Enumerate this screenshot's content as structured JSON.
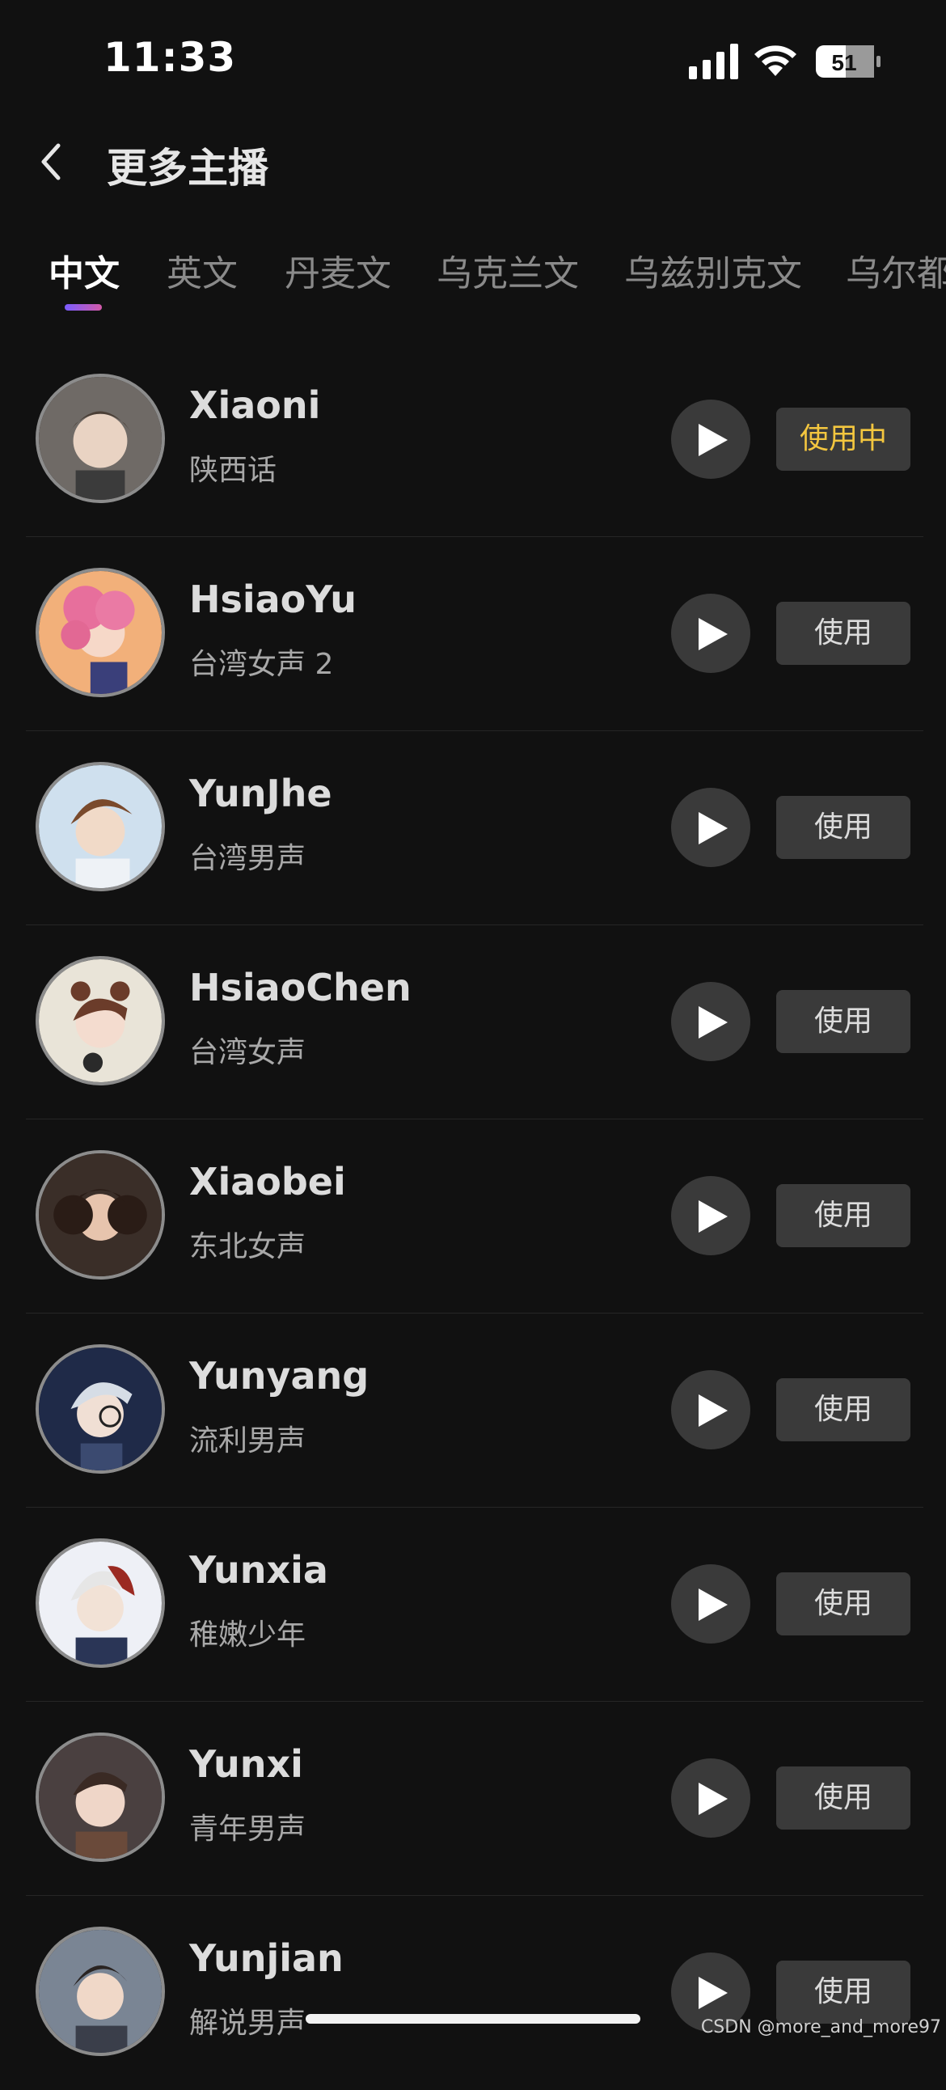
{
  "status_bar": {
    "time": "11:33",
    "battery_level": "51",
    "icons": [
      "cellular-signal-icon",
      "wifi-icon",
      "battery-icon"
    ]
  },
  "header": {
    "back_icon": "chevron-left-icon",
    "title": "更多主播"
  },
  "tabs": [
    {
      "label": "中文",
      "active": true
    },
    {
      "label": "英文",
      "active": false
    },
    {
      "label": "丹麦文",
      "active": false
    },
    {
      "label": "乌克兰文",
      "active": false
    },
    {
      "label": "乌兹别克文",
      "active": false
    },
    {
      "label": "乌尔都",
      "active": false
    }
  ],
  "voices": [
    {
      "name": "Xiaoni",
      "description": "陕西话",
      "button": "使用中",
      "in_use": true
    },
    {
      "name": "HsiaoYu",
      "description": "台湾女声 2",
      "button": "使用",
      "in_use": false
    },
    {
      "name": "YunJhe",
      "description": "台湾男声",
      "button": "使用",
      "in_use": false
    },
    {
      "name": "HsiaoChen",
      "description": "台湾女声",
      "button": "使用",
      "in_use": false
    },
    {
      "name": "Xiaobei",
      "description": "东北女声",
      "button": "使用",
      "in_use": false
    },
    {
      "name": "Yunyang",
      "description": "流利男声",
      "button": "使用",
      "in_use": false
    },
    {
      "name": "Yunxia",
      "description": "稚嫩少年",
      "button": "使用",
      "in_use": false
    },
    {
      "name": "Yunxi",
      "description": "青年男声",
      "button": "使用",
      "in_use": false
    },
    {
      "name": "Yunjian",
      "description": "解说男声",
      "button": "使用",
      "in_use": false
    }
  ],
  "colors": {
    "background": "#111111",
    "button_bg": "#3a3a3a",
    "in_use_text": "#f3c63f",
    "tab_underline": "#a35ad0"
  },
  "watermark": "CSDN @more_and_more97"
}
